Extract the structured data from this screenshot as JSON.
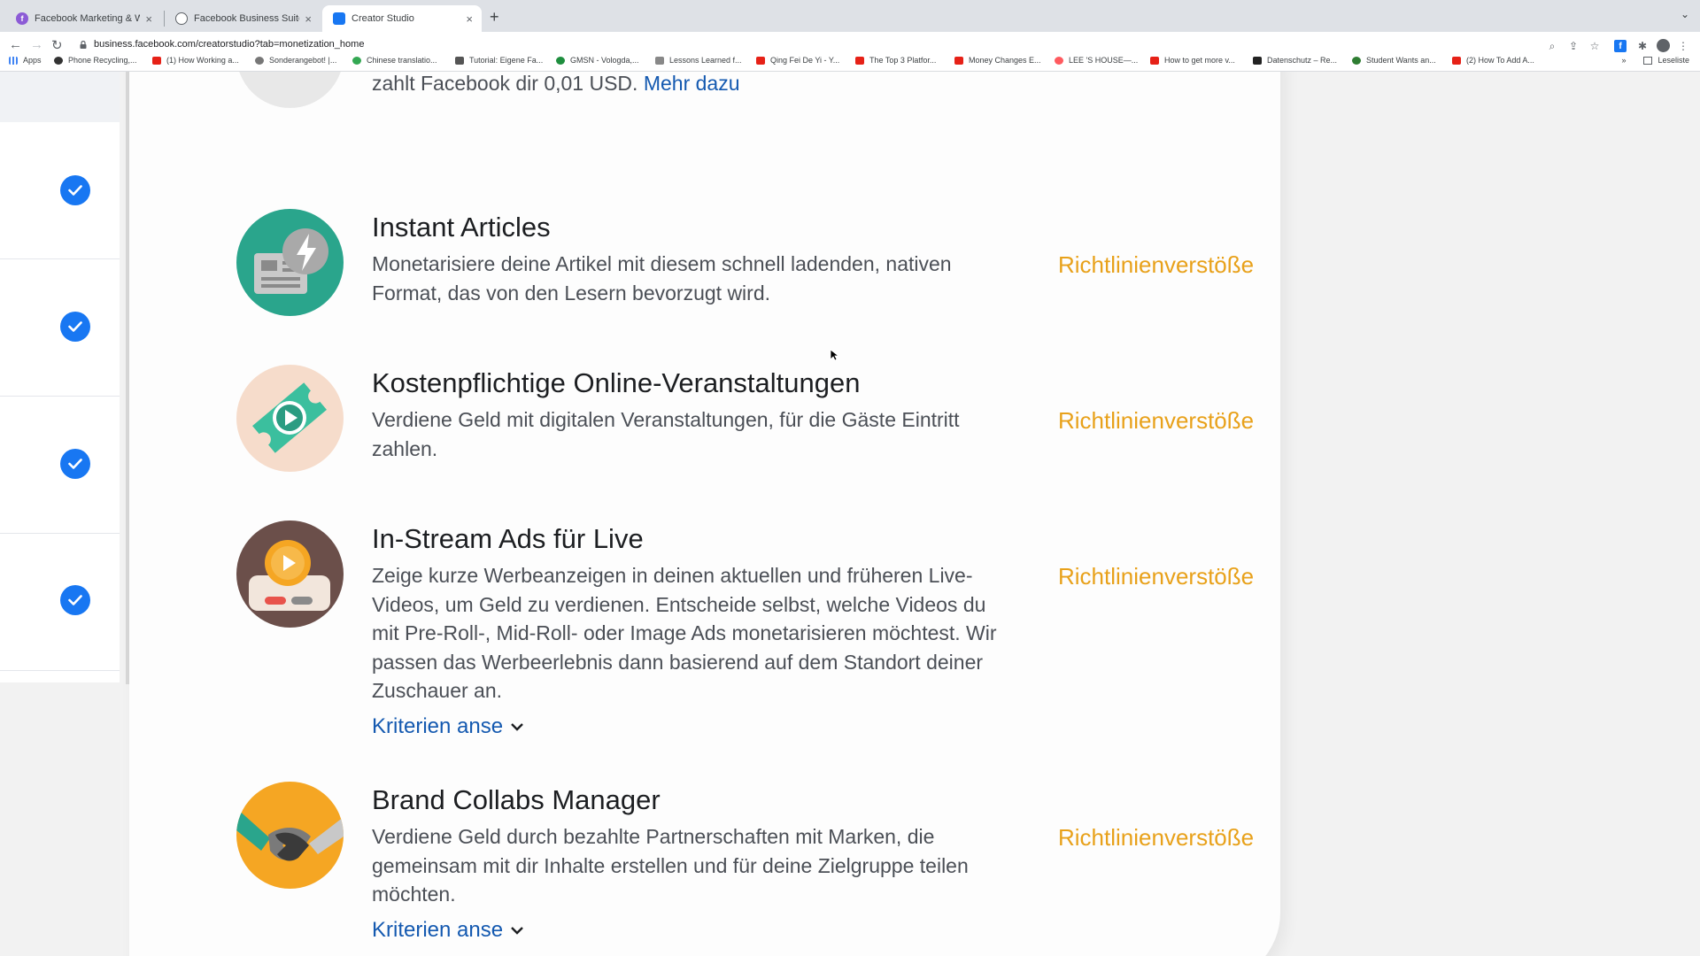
{
  "browser": {
    "tabs": [
      {
        "title": "Facebook Marketing & Werbe",
        "active": false
      },
      {
        "title": "Facebook Business Suite",
        "active": false
      },
      {
        "title": "Creator Studio",
        "active": true
      }
    ],
    "url": "business.facebook.com/creatorstudio?tab=monetization_home",
    "bookmarks": [
      "Apps",
      "Phone Recycling,...",
      "(1) How Working a...",
      "Sonderangebot! |...",
      "Chinese translatio...",
      "Tutorial: Eigene Fa...",
      "GMSN - Vologda,...",
      "Lessons Learned f...",
      "Qing Fei De Yi - Y...",
      "The Top 3 Platfor...",
      "Money Changes E...",
      "LEE 'S HOUSE—...",
      "How to get more v...",
      "Datenschutz – Re...",
      "Student Wants an...",
      "(2) How To Add A..."
    ],
    "reading_list": "Leseliste",
    "more_bookmarks": "»"
  },
  "previous_item": {
    "text_tail": "zahlt Facebook dir 0,01 USD.",
    "link": "Mehr dazu"
  },
  "items": [
    {
      "title": "Instant Articles",
      "description": "Monetarisiere deine Artikel mit diesem schnell ladenden, nativen Format, das von den Lesern bevorzugt wird.",
      "status": "Richtlinienverstöße",
      "icon": "instant-articles-icon",
      "icon_bg": "#2aa58c"
    },
    {
      "title": "Kostenpflichtige Online-Veranstaltungen",
      "description": "Verdiene Geld mit digitalen Veranstaltungen, für die Gäste Eintritt zahlen.",
      "status": "Richtlinienverstöße",
      "icon": "ticket-play-icon",
      "icon_bg": "#f6dccb"
    },
    {
      "title": "In-Stream Ads für Live",
      "description": "Zeige kurze Werbeanzeigen in deinen aktuellen und früheren Live-Videos, um Geld zu verdienen. Entscheide selbst, welche Videos du mit Pre-Roll-, Mid-Roll- oder Image Ads monetarisieren möchtest. Wir passen das Werbeerlebnis dann basierend auf dem Standort deiner Zuschauer an.",
      "criteria": "Kriterien anse",
      "status": "Richtlinienverstöße",
      "icon": "live-ads-icon",
      "icon_bg": "#6b4f4a"
    },
    {
      "title": "Brand Collabs Manager",
      "description": "Verdiene Geld durch bezahlte Partnerschaften mit Marken, die gemeinsam mit dir Inhalte erstellen und für deine Zielgruppe teilen möchten.",
      "criteria": "Kriterien anse",
      "status": "Richtlinienverstöße",
      "icon": "handshake-icon",
      "icon_bg": "#f5a623"
    }
  ],
  "colors": {
    "status": "#e8a11a",
    "link": "#1459b0",
    "check": "#1877f2"
  }
}
